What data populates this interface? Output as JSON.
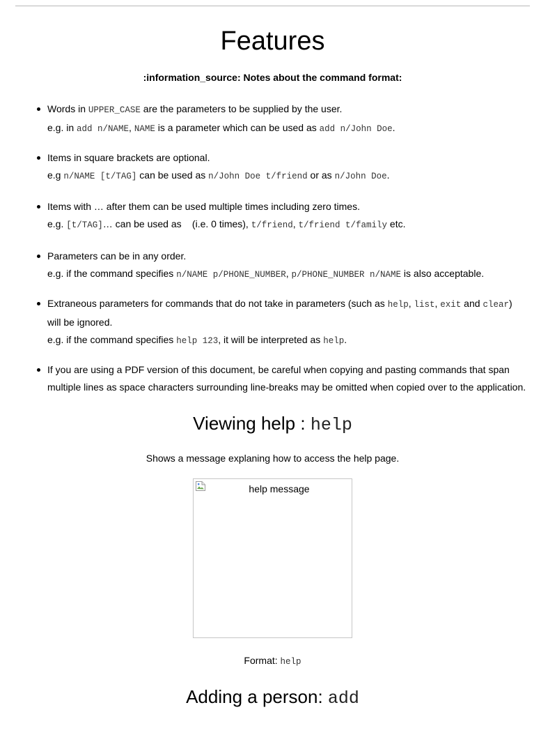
{
  "page": {
    "title": "Features",
    "note_heading": ":information_source: Notes about the command format:"
  },
  "notes": [
    {
      "line1": [
        {
          "t": "Words in "
        },
        {
          "c": "UPPER_CASE"
        },
        {
          "t": " are the parameters to be supplied by the user."
        }
      ],
      "line2": [
        {
          "t": "e.g. in "
        },
        {
          "c": "add n/NAME"
        },
        {
          "t": ", "
        },
        {
          "c": "NAME"
        },
        {
          "t": " is a parameter which can be used as "
        },
        {
          "c": "add n/John Doe"
        },
        {
          "t": "."
        }
      ]
    },
    {
      "line1": [
        {
          "t": "Items in square brackets are optional."
        }
      ],
      "line2": [
        {
          "t": "e.g "
        },
        {
          "c": "n/NAME [t/TAG]"
        },
        {
          "t": " can be used as "
        },
        {
          "c": "n/John Doe t/friend"
        },
        {
          "t": " or as "
        },
        {
          "c": "n/John Doe"
        },
        {
          "t": "."
        }
      ]
    },
    {
      "line1": [
        {
          "t": "Items with … after them can be used multiple times including zero times."
        }
      ],
      "line2": [
        {
          "t": "e.g. "
        },
        {
          "c": "[t/TAG]"
        },
        {
          "t": "… can be used as "
        },
        {
          "c": " "
        },
        {
          "t": " (i.e. 0 times), "
        },
        {
          "c": "t/friend"
        },
        {
          "t": ", "
        },
        {
          "c": "t/friend t/family"
        },
        {
          "t": " etc."
        }
      ]
    },
    {
      "line1": [
        {
          "t": "Parameters can be in any order."
        }
      ],
      "line2": [
        {
          "t": "e.g. if the command specifies "
        },
        {
          "c": "n/NAME p/PHONE_NUMBER"
        },
        {
          "t": ", "
        },
        {
          "c": "p/PHONE_NUMBER n/NAME"
        },
        {
          "t": " is also acceptable."
        }
      ]
    },
    {
      "line1": [
        {
          "t": "Extraneous parameters for commands that do not take in parameters (such as "
        },
        {
          "c": "help"
        },
        {
          "t": ", "
        },
        {
          "c": "list"
        },
        {
          "t": ", "
        },
        {
          "c": "exit"
        },
        {
          "t": " and "
        },
        {
          "c": "clear"
        },
        {
          "t": ")"
        }
      ],
      "line1b": [
        {
          "t": "will be ignored."
        }
      ],
      "line2": [
        {
          "t": "e.g. if the command specifies "
        },
        {
          "c": "help 123"
        },
        {
          "t": ", it will be interpreted as "
        },
        {
          "c": "help"
        },
        {
          "t": "."
        }
      ]
    },
    {
      "line1": [
        {
          "t": "If you are using a PDF version of this document, be careful when copying and pasting commands that span"
        }
      ],
      "line2": [
        {
          "t": "multiple lines as space characters surrounding line-breaks may be omitted when copied over to the application."
        }
      ]
    }
  ],
  "help_section": {
    "heading_text": "Viewing help : ",
    "heading_code": "help",
    "description": "Shows a message explaning how to access the help page.",
    "image_alt": "help message",
    "format_label": "Format: ",
    "format_code": "help"
  },
  "add_section": {
    "heading_text": "Adding a person: ",
    "heading_code": "add"
  }
}
